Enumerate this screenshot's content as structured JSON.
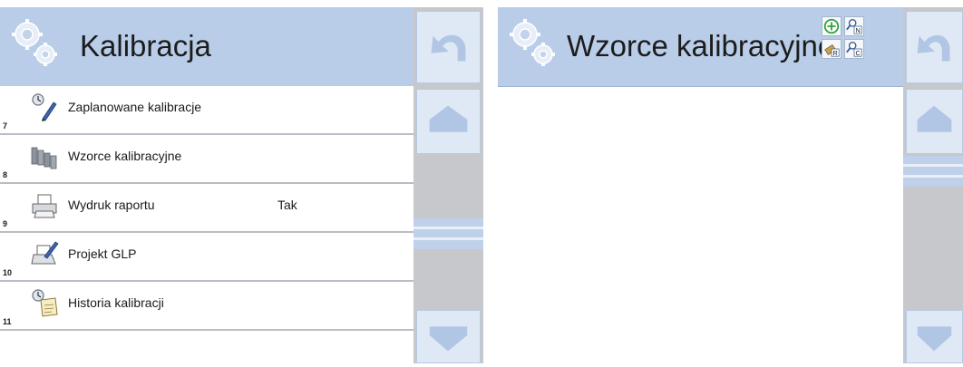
{
  "left_screen": {
    "title": "Kalibracja",
    "items": [
      {
        "number": "7",
        "label": "Zaplanowane kalibracje",
        "value": ""
      },
      {
        "number": "8",
        "label": "Wzorce kalibracyjne",
        "value": ""
      },
      {
        "number": "9",
        "label": "Wydruk raportu",
        "value": "Tak"
      },
      {
        "number": "10",
        "label": "Projekt GLP",
        "value": ""
      },
      {
        "number": "11",
        "label": "Historia kalibracji",
        "value": ""
      }
    ]
  },
  "right_screen": {
    "title": "Wzorce kalibracyjne",
    "toolbar": {
      "add_icon": "plus-circle-icon",
      "search_name_letter": "N",
      "search_code_letter": "C",
      "export_letter": "R"
    }
  },
  "colors": {
    "header": "#b9cde8",
    "sidebar": "#c6c8cb",
    "sidebar_button": "#dfe9f6",
    "row_divider": "#b9bec6"
  }
}
